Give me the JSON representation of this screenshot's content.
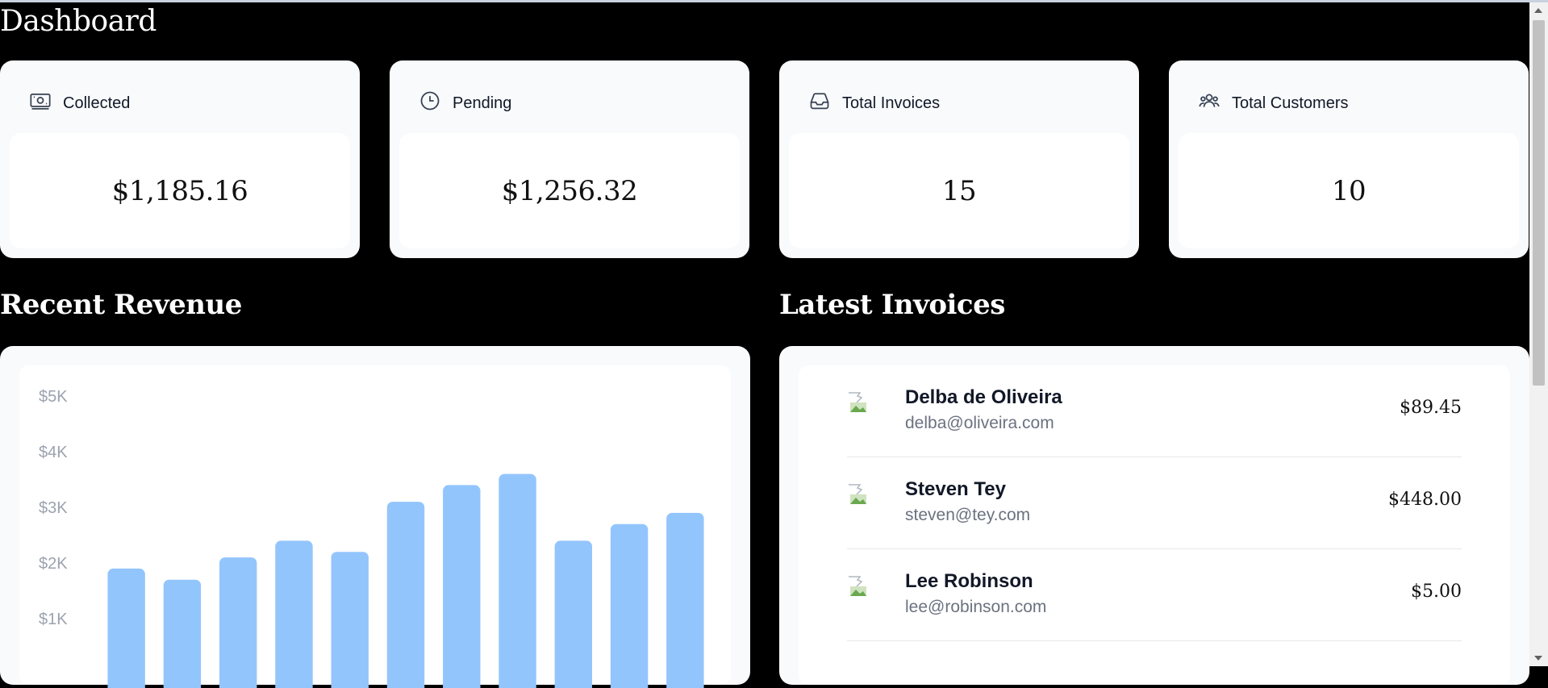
{
  "page": {
    "title": "Dashboard"
  },
  "cards": [
    {
      "label": "Collected",
      "value": "$1,185.16",
      "icon": "banknotes-icon"
    },
    {
      "label": "Pending",
      "value": "$1,256.32",
      "icon": "clock-icon"
    },
    {
      "label": "Total Invoices",
      "value": "15",
      "icon": "inbox-icon"
    },
    {
      "label": "Total Customers",
      "value": "10",
      "icon": "user-group-icon"
    }
  ],
  "revenue": {
    "title": "Recent Revenue"
  },
  "chart_data": {
    "type": "bar",
    "title": "",
    "xlabel": "",
    "ylabel": "",
    "ylim": [
      0,
      5000
    ],
    "y_ticks": [
      {
        "value": 5000,
        "label": "$5K"
      },
      {
        "value": 4000,
        "label": "$4K"
      },
      {
        "value": 3000,
        "label": "$3K"
      },
      {
        "value": 2000,
        "label": "$2K"
      },
      {
        "value": 1000,
        "label": "$1K"
      }
    ],
    "values": [
      1900,
      1700,
      2100,
      2400,
      2200,
      3100,
      3400,
      3600,
      2400,
      2700,
      2900
    ],
    "bar_color": "#93c5fd",
    "grid": false
  },
  "invoices": {
    "title": "Latest Invoices",
    "items": [
      {
        "name": "Delba de Oliveira",
        "email": "delba@oliveira.com",
        "amount": "$89.45"
      },
      {
        "name": "Steven Tey",
        "email": "steven@tey.com",
        "amount": "$448.00"
      },
      {
        "name": "Lee Robinson",
        "email": "lee@robinson.com",
        "amount": "$5.00"
      }
    ]
  },
  "colors": {
    "background": "#000000",
    "card": "#f8fafc",
    "accent_bar": "#93c5fd"
  }
}
